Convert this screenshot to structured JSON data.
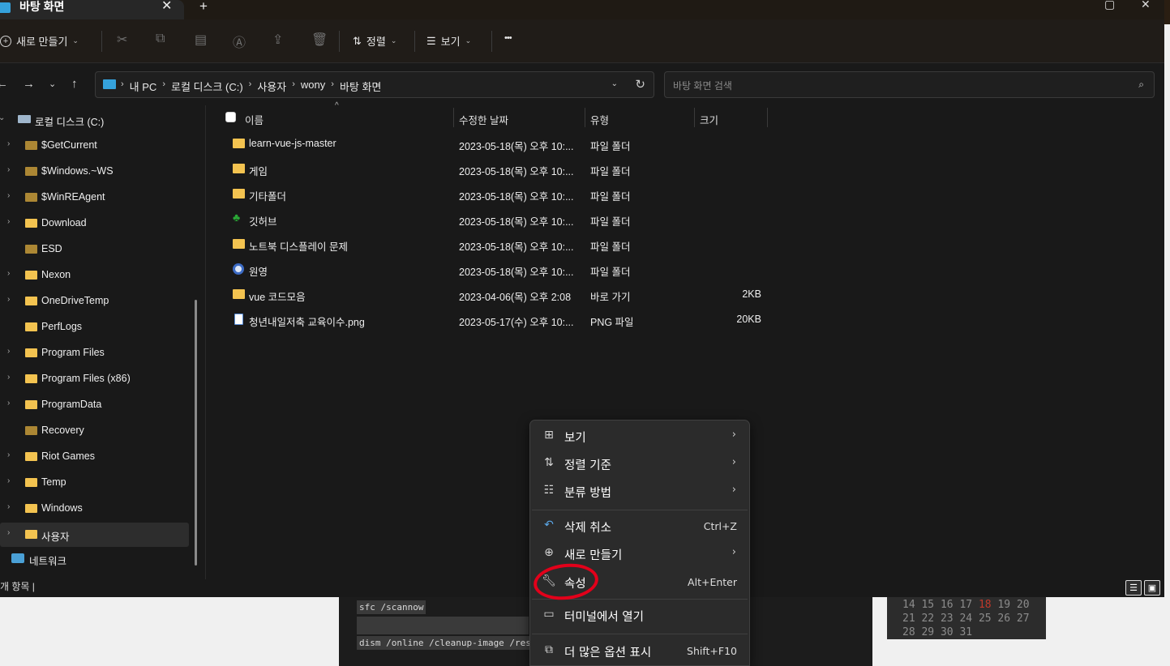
{
  "background": {
    "code_lines": [
      "sfc /scannow",
      "dism /online /cleanup-image /restore"
    ],
    "calendar": {
      "rows": [
        [
          "14",
          "15",
          "16",
          "17",
          "18",
          "19",
          "20"
        ],
        [
          "21",
          "22",
          "23",
          "24",
          "25",
          "26",
          "27"
        ],
        [
          "28",
          "29",
          "30",
          "31"
        ]
      ],
      "highlight": "18"
    }
  },
  "window": {
    "tab_title": "바탕 화면",
    "close_glyph": "✕",
    "new_tab_glyph": "+",
    "toolbar": {
      "new_label": "새로 만들기",
      "sort_label": "정렬",
      "view_label": "보기",
      "more_glyph": "•••"
    },
    "breadcrumb": [
      "내 PC",
      "로컬 디스크 (C:)",
      "사용자",
      "wony",
      "바탕 화면"
    ],
    "search_placeholder": "바탕 화면 검색"
  },
  "nav_pane": {
    "root": "로컬 디스크 (C:)",
    "items": [
      {
        "label": "$GetCurrent",
        "chevron": true
      },
      {
        "label": "$Windows.~WS",
        "chevron": true
      },
      {
        "label": "$WinREAgent",
        "chevron": true
      },
      {
        "label": "Download",
        "chevron": true
      },
      {
        "label": "ESD",
        "chevron": false
      },
      {
        "label": "Nexon",
        "chevron": true
      },
      {
        "label": "OneDriveTemp",
        "chevron": true
      },
      {
        "label": "PerfLogs",
        "chevron": false
      },
      {
        "label": "Program Files",
        "chevron": true
      },
      {
        "label": "Program Files (x86)",
        "chevron": true
      },
      {
        "label": "ProgramData",
        "chevron": true
      },
      {
        "label": "Recovery",
        "chevron": false
      },
      {
        "label": "Riot Games",
        "chevron": true
      },
      {
        "label": "Temp",
        "chevron": true
      },
      {
        "label": "Windows",
        "chevron": true
      },
      {
        "label": "사용자",
        "chevron": true
      }
    ],
    "network": "네트워크"
  },
  "columns": {
    "name": "이름",
    "modified": "수정한 날짜",
    "type": "유형",
    "size": "크기"
  },
  "files": [
    {
      "name": "learn-vue-js-master",
      "modified": "2023-05-18(목) 오후 10:...",
      "type": "파일 폴더",
      "size": "",
      "icon": "folder-icon"
    },
    {
      "name": "게임",
      "modified": "2023-05-18(목) 오후 10:...",
      "type": "파일 폴더",
      "size": "",
      "icon": "folder-icon"
    },
    {
      "name": "기타폴더",
      "modified": "2023-05-18(목) 오후 10:...",
      "type": "파일 폴더",
      "size": "",
      "icon": "folder-icon"
    },
    {
      "name": "깃허브",
      "modified": "2023-05-18(목) 오후 10:...",
      "type": "파일 폴더",
      "size": "",
      "icon": "tree-icon"
    },
    {
      "name": "노트북 디스플레이 문제",
      "modified": "2023-05-18(목) 오후 10:...",
      "type": "파일 폴더",
      "size": "",
      "icon": "folder-icon"
    },
    {
      "name": "원영",
      "modified": "2023-05-18(목) 오후 10:...",
      "type": "파일 폴더",
      "size": "",
      "icon": "ring-icon"
    },
    {
      "name": "vue 코드모음",
      "modified": "2023-04-06(목) 오후 2:08",
      "type": "바로 가기",
      "size": "2KB",
      "icon": "shortcut-icon"
    },
    {
      "name": "청년내일저축 교육이수.png",
      "modified": "2023-05-17(수) 오후 10:...",
      "type": "PNG 파일",
      "size": "20KB",
      "icon": "png-file-icon"
    }
  ],
  "status_text": "개 항목  |",
  "context_menu": {
    "view": "보기",
    "sort_by": "정렬 기준",
    "group_by": "분류 방법",
    "undo_delete": "삭제 취소",
    "undo_shortcut": "Ctrl+Z",
    "new": "새로 만들기",
    "properties": "속성",
    "properties_shortcut": "Alt+Enter",
    "open_terminal": "터미널에서 열기",
    "more_options": "더 많은 옵션 표시",
    "more_options_shortcut": "Shift+F10"
  },
  "colors": {
    "accent": "#35a2dc",
    "folder": "#f3c350",
    "annotation_ring": "#e2001a"
  }
}
